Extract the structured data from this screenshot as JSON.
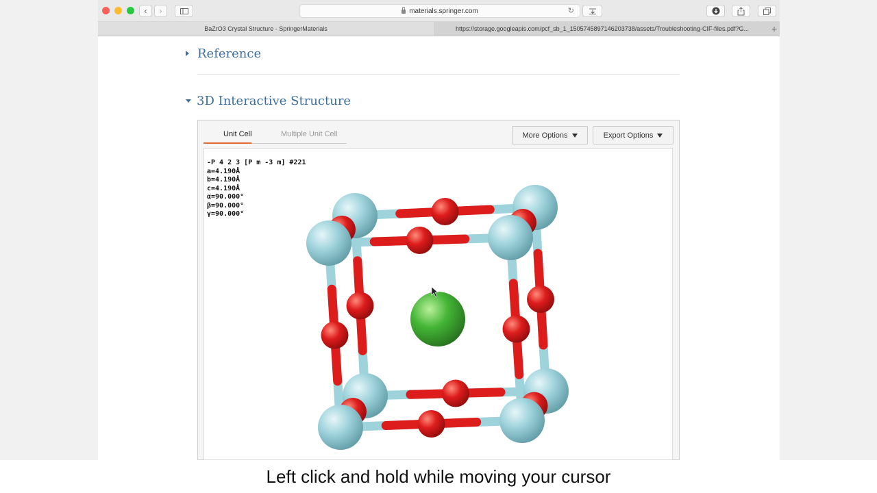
{
  "browser": {
    "url": "materials.springer.com",
    "tabs": [
      {
        "label": "BaZrO3 Crystal Structure - SpringerMaterials"
      },
      {
        "label": "https://storage.googleapis.com/pcf_sb_1_1505745897146203738/assets/Troubleshooting-CIF-files.pdf?G..."
      }
    ],
    "new_tab_symbol": "+",
    "icons": [
      "back-icon",
      "forward-icon",
      "sidebar-icon",
      "reload-icon",
      "downloads-icon",
      "share-icon",
      "tabs-icon"
    ]
  },
  "page": {
    "sections": [
      {
        "title": "Reference",
        "state": "collapsed"
      },
      {
        "title": "3D Interactive Structure",
        "state": "expanded"
      }
    ]
  },
  "viewer": {
    "tabs": [
      {
        "label": "Unit Cell",
        "active": true
      },
      {
        "label": "Multiple Unit Cell",
        "active": false
      }
    ],
    "more_options": "More Options",
    "export_options": "Export Options",
    "cell_info": "-P 4 2 3 [P m -3 m] #221\na=4.190Å\nb=4.190Å\nc=4.190Å\nα=90.000°\nβ=90.000°\nγ=90.000°",
    "atom_colors": {
      "corner": "#9fd3dc",
      "edge": "#dd1c1c",
      "center": "#44b536"
    }
  },
  "caption": "Left click and hold while moving your cursor"
}
